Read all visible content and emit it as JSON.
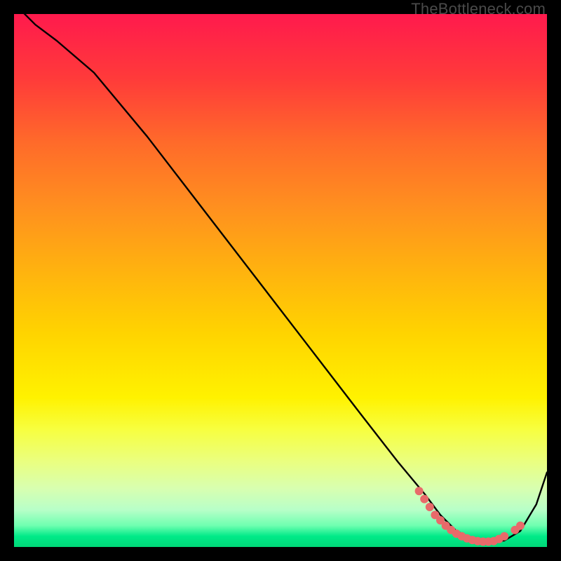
{
  "watermark": "TheBottleneck.com",
  "chart_data": {
    "type": "line",
    "title": "",
    "xlabel": "",
    "ylabel": "",
    "xlim": [
      0,
      100
    ],
    "ylim": [
      0,
      100
    ],
    "series": [
      {
        "name": "bottleneck-curve",
        "style": "line",
        "color": "#000000",
        "x": [
          0,
          4,
          8,
          15,
          25,
          35,
          45,
          55,
          65,
          72,
          77,
          80,
          83,
          86,
          89,
          92,
          95,
          98,
          100
        ],
        "values": [
          102,
          98,
          95,
          89,
          77,
          64,
          51,
          38,
          25,
          16,
          10,
          6,
          3,
          1.5,
          1,
          1.2,
          3,
          8,
          14
        ]
      },
      {
        "name": "optimum-markers",
        "style": "markers",
        "color": "#e86a6a",
        "x": [
          76,
          77,
          78,
          79,
          80,
          81,
          82,
          83,
          84,
          85,
          86,
          87,
          88,
          89,
          90,
          91,
          92,
          94,
          95
        ],
        "values": [
          10.5,
          9,
          7.5,
          6,
          5,
          4,
          3.2,
          2.5,
          2,
          1.6,
          1.3,
          1.1,
          1,
          1,
          1.1,
          1.5,
          2,
          3.2,
          4
        ]
      }
    ]
  }
}
